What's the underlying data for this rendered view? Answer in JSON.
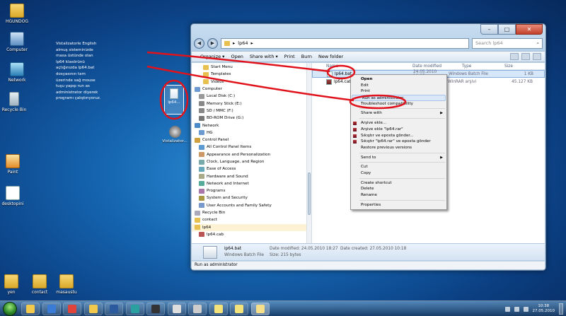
{
  "desktop": {
    "icons": [
      {
        "label": "HGUNDOG",
        "kind": "folder"
      },
      {
        "label": "Computer",
        "kind": "computer"
      },
      {
        "label": "Network",
        "kind": "network"
      },
      {
        "label": "Recycle Bin",
        "kind": "bin"
      },
      {
        "label": "Paint",
        "kind": "paint"
      },
      {
        "label": "desktopini",
        "kind": "doc"
      },
      {
        "label": "yen",
        "kind": "folder"
      },
      {
        "label": "contact",
        "kind": "folder"
      },
      {
        "label": "masaustu",
        "kind": "folder"
      }
    ],
    "note_lines": [
      "Vistalizatorle English",
      "almuş sisteminizde",
      "masa üstünde olan",
      "lp64 klasörünü",
      "açtığınızda lp64.bat",
      "dosyasının tam",
      "üzerinde sağ mouse",
      "tuşu yapıp run as",
      "administrator diyerek",
      "programı çalıştırıyoruz."
    ],
    "bat_icon_label": "lp64...",
    "vistalizator_label": "Vistalizator..."
  },
  "window": {
    "breadcrumb": "lp64",
    "search_placeholder": "Search lp64",
    "toolbar": [
      "Organize ▾",
      "Open",
      "Share with ▾",
      "Print",
      "Burn",
      "New folder"
    ],
    "nav_items": [
      {
        "label": "Start Menu",
        "indent": 16
      },
      {
        "label": "Templates",
        "indent": 16
      },
      {
        "label": "Videos",
        "indent": 16
      },
      {
        "label": "Computer",
        "indent": 4
      },
      {
        "label": "Local Disk (C:)",
        "indent": 10
      },
      {
        "label": "Memory Stick (E:)",
        "indent": 10
      },
      {
        "label": "SD / MMC (F:)",
        "indent": 10
      },
      {
        "label": "BD-ROM Drive (G:)",
        "indent": 10
      },
      {
        "label": "Network",
        "indent": 4
      },
      {
        "label": "HG",
        "indent": 10
      },
      {
        "label": "Control Panel",
        "indent": 4
      },
      {
        "label": "All Control Panel Items",
        "indent": 10
      },
      {
        "label": "Appearance and Personalization",
        "indent": 10
      },
      {
        "label": "Clock, Language, and Region",
        "indent": 10
      },
      {
        "label": "Ease of Access",
        "indent": 10
      },
      {
        "label": "Hardware and Sound",
        "indent": 10
      },
      {
        "label": "Network and Internet",
        "indent": 10
      },
      {
        "label": "Programs",
        "indent": 10
      },
      {
        "label": "System and Security",
        "indent": 10
      },
      {
        "label": "User Accounts and Family Safety",
        "indent": 10
      },
      {
        "label": "Recycle Bin",
        "indent": 4
      },
      {
        "label": "contact",
        "indent": 4
      },
      {
        "label": "lp64",
        "indent": 4
      },
      {
        "label": "lp64.cab",
        "indent": 10
      }
    ],
    "columns": [
      "Name",
      "Date modified",
      "Type",
      "Size"
    ],
    "files": [
      {
        "name": "lp64.bat",
        "date": "24.05.2010 18:27",
        "type": "Windows Batch File",
        "size": "1 KB",
        "selected": true
      },
      {
        "name": "lp64.cab",
        "date": "",
        "type": "WinRAR arşivi",
        "size": "45.127 KB",
        "selected": false
      }
    ],
    "details": {
      "name": "lp64.bat",
      "type": "Windows Batch File",
      "modified": "Date modified: 24.05.2010 18:27",
      "size": "Size: 215 bytes",
      "created": "Date created: 27.05.2010 10:18"
    },
    "status": "Run as administrator"
  },
  "context_menu": [
    {
      "label": "Open",
      "bold": true
    },
    {
      "label": "Edit"
    },
    {
      "label": "Print"
    },
    {
      "label": "Run as administrator",
      "highlight": true
    },
    {
      "label": "Troubleshoot compatibility"
    },
    {
      "sep": true
    },
    {
      "label": "Share with",
      "sub": true
    },
    {
      "sep": true
    },
    {
      "label": "Arşive ekle...",
      "rar": true
    },
    {
      "label": "Arşive ekle \"lp64.rar\"",
      "rar": true
    },
    {
      "label": "Sıkıştır ve eposta gönder...",
      "rar": true
    },
    {
      "label": "Sıkıştır \"lp64.rar\" ve eposta gönder",
      "rar": true
    },
    {
      "label": "Restore previous versions"
    },
    {
      "sep": true
    },
    {
      "label": "Send to",
      "sub": true
    },
    {
      "sep": true
    },
    {
      "label": "Cut"
    },
    {
      "label": "Copy"
    },
    {
      "sep": true
    },
    {
      "label": "Create shortcut"
    },
    {
      "label": "Delete"
    },
    {
      "label": "Rename"
    },
    {
      "sep": true
    },
    {
      "label": "Properties"
    }
  ],
  "taskbar": {
    "apps": [
      "explorer",
      "media",
      "chrome",
      "folder",
      "photoshop",
      "tool",
      "game",
      "doc",
      "doc2",
      "notes",
      "notes2",
      "active"
    ],
    "clock_time": "10:38",
    "clock_date": "27.05.2010"
  },
  "colors": {
    "annotation": "#e0121c",
    "highlight": "#dbe8f8"
  }
}
